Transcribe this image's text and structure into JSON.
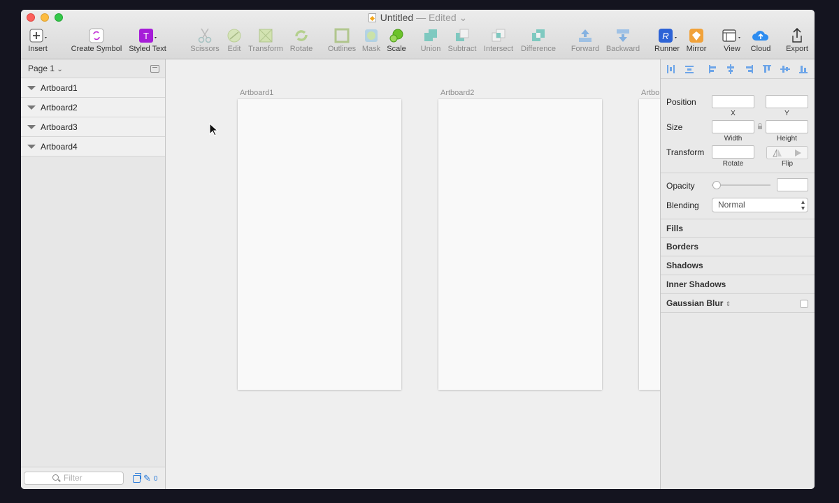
{
  "window": {
    "title": "Untitled",
    "status": "— Edited"
  },
  "toolbar": {
    "insert": "Insert",
    "create_symbol": "Create Symbol",
    "styled_text": "Styled Text",
    "scissors": "Scissors",
    "edit": "Edit",
    "transform": "Transform",
    "rotate": "Rotate",
    "outlines": "Outlines",
    "mask": "Mask",
    "scale": "Scale",
    "union": "Union",
    "subtract": "Subtract",
    "intersect": "Intersect",
    "difference": "Difference",
    "forward": "Forward",
    "backward": "Backward",
    "runner": "Runner",
    "mirror": "Mirror",
    "view": "View",
    "cloud": "Cloud",
    "export": "Export"
  },
  "sidebar": {
    "page": "Page 1",
    "layers": [
      "Artboard1",
      "Artboard2",
      "Artboard3",
      "Artboard4"
    ],
    "filter_placeholder": "Filter",
    "edited_count": "0"
  },
  "canvas": {
    "artboards": [
      "Artboard1",
      "Artboard2",
      "Artbo"
    ]
  },
  "inspector": {
    "position_label": "Position",
    "x_label": "X",
    "y_label": "Y",
    "size_label": "Size",
    "width_label": "Width",
    "height_label": "Height",
    "transform_label": "Transform",
    "rotate_label": "Rotate",
    "flip_label": "Flip",
    "opacity_label": "Opacity",
    "blending_label": "Blending",
    "blending_value": "Normal",
    "sections": [
      "Fills",
      "Borders",
      "Shadows",
      "Inner Shadows",
      "Gaussian Blur"
    ]
  },
  "colors": {
    "accent_blue": "#2a7bd9",
    "styled_text_purple": "#a61cd8",
    "runner_blue": "#2d63d6",
    "mirror_orange": "#f1a23a",
    "cloud_blue": "#2d8cf0"
  }
}
